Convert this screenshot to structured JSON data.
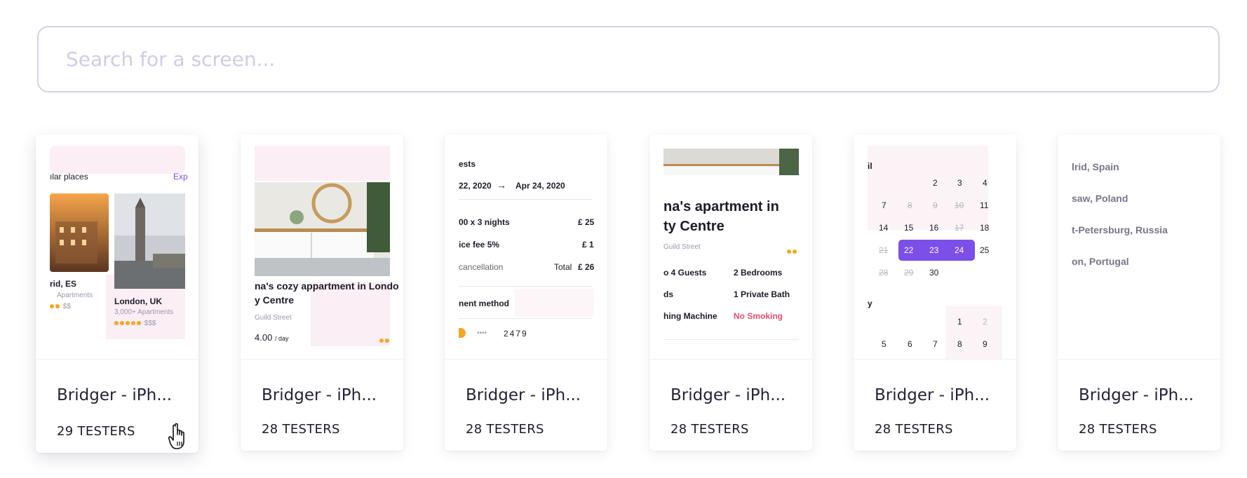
{
  "search": {
    "placeholder": "Search for a screen..."
  },
  "cards": [
    {
      "title": "Bridger - iPh...",
      "testers": "29 TESTERS",
      "screen": {
        "section": "ılar places",
        "action": "Exp",
        "city1": "rid, ES",
        "city1_sub": "Apartments",
        "city1_price": "$$",
        "city2": "London, UK",
        "city2_sub": "3,000+ Apartments",
        "city2_price": "$$$"
      }
    },
    {
      "title": "Bridger - iPh...",
      "testers": "28 TESTERS",
      "screen": {
        "heading_line1": "na's cozy appartment in Londo",
        "heading_line2": "y Centre",
        "address": "Guild Street",
        "price": "4.00",
        "unit": "/ day"
      }
    },
    {
      "title": "Bridger - iPh...",
      "testers": "28 TESTERS",
      "screen": {
        "label": "ests",
        "date_from": "22, 2020",
        "arrow": "→",
        "date_to": "Apr 24, 2020",
        "rows": [
          {
            "left": "00 x 3 nights",
            "right": "£ 25"
          },
          {
            "left": "ice fee 5%",
            "right": "£ 1"
          },
          {
            "left": "cancellation",
            "mid": "Total",
            "right": "£ 26"
          }
        ],
        "payment_label": "nent method",
        "card_digits": "2479",
        "card_mask": "••••"
      }
    },
    {
      "title": "Bridger - iPh...",
      "testers": "28 TESTERS",
      "screen": {
        "heading_line1": "na's apartment in",
        "heading_line2": "ty Centre",
        "address": "Guild Street",
        "features": [
          {
            "left": "o 4 Guests",
            "right": "2 Bedrooms"
          },
          {
            "left": "ds",
            "right": "1 Private Bath"
          },
          {
            "left": "hing Machine",
            "right": "No Smoking"
          }
        ]
      }
    },
    {
      "title": "Bridger - iPh...",
      "testers": "28 TESTERS",
      "screen": {
        "month1": "il",
        "month2": "y",
        "row1": [
          "2",
          "3",
          "4"
        ],
        "row2": [
          "7",
          "8",
          "9",
          "10",
          "11"
        ],
        "row3": [
          "14",
          "15",
          "16",
          "17",
          "18"
        ],
        "row4": [
          "21",
          "22",
          "23",
          "24",
          "25"
        ],
        "row5": [
          "28",
          "29",
          "30"
        ],
        "row6": [
          "1",
          "2"
        ],
        "row7": [
          "5",
          "6",
          "7",
          "8",
          "9"
        ]
      }
    },
    {
      "title": "Bridger - iPh...",
      "testers": "28 TESTERS",
      "screen": {
        "places": [
          "lrid, Spain",
          "saw, Poland",
          "t-Petersburg, Russia",
          "on, Portugal"
        ]
      }
    }
  ],
  "colors": {
    "accent": "#7b4fe8",
    "warning": "#f5a623",
    "danger": "#e94b6e"
  },
  "icons": {
    "cursor": "pointing-hand-cursor-icon"
  }
}
